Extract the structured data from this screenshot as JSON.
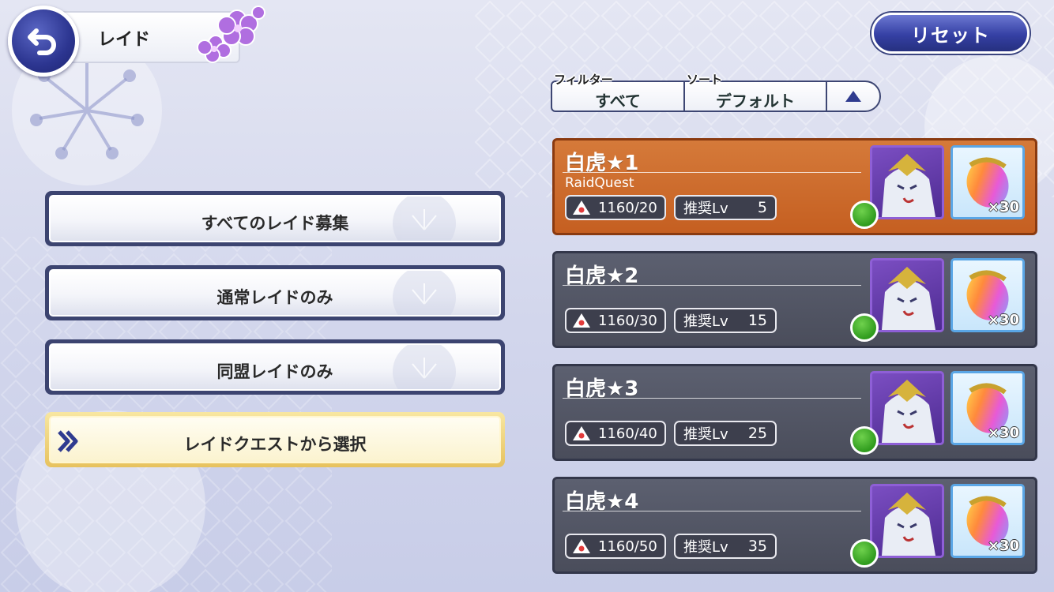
{
  "header": {
    "title": "レイド",
    "back_icon": "back-arrow-icon",
    "reset_label": "リセット"
  },
  "filter_sort": {
    "filter_tag": "フィルター",
    "filter_value": "すべて",
    "sort_tag": "ソート",
    "sort_value": "デフォルト",
    "order_icon": "triangle-up-icon"
  },
  "menu": {
    "items": [
      {
        "label": "すべてのレイド募集",
        "selected": false
      },
      {
        "label": "通常レイドのみ",
        "selected": false
      },
      {
        "label": "同盟レイドのみ",
        "selected": false
      },
      {
        "label": "レイドクエストから選択",
        "selected": true
      }
    ]
  },
  "raids": [
    {
      "name": "白虎★1",
      "subtitle": "RaidQuest",
      "cost": "1160/20",
      "lv_label": "推奨Lv",
      "lv": "5",
      "reward_qty": "×30",
      "active": true
    },
    {
      "name": "白虎★2",
      "subtitle": "",
      "cost": "1160/30",
      "lv_label": "推奨Lv",
      "lv": "15",
      "reward_qty": "×30",
      "active": false
    },
    {
      "name": "白虎★3",
      "subtitle": "",
      "cost": "1160/40",
      "lv_label": "推奨Lv",
      "lv": "25",
      "reward_qty": "×30",
      "active": false
    },
    {
      "name": "白虎★4",
      "subtitle": "",
      "cost": "1160/50",
      "lv_label": "推奨Lv",
      "lv": "35",
      "reward_qty": "×30",
      "active": false
    }
  ],
  "colors": {
    "active_card": "#c55f21",
    "inactive_card": "#4a4d5b",
    "accent_blue": "#3540a4",
    "element_green": "#2f9b1d"
  }
}
